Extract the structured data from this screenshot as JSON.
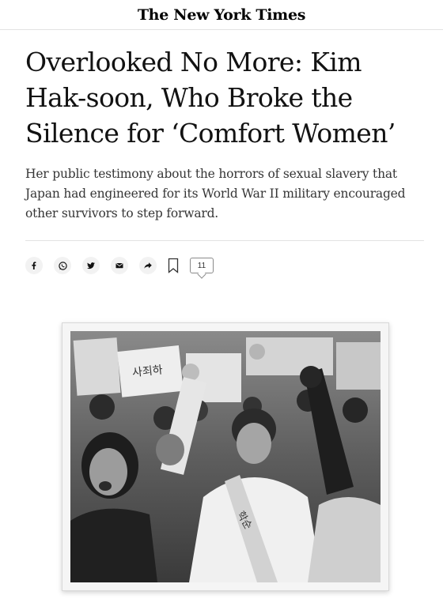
{
  "masthead": {
    "logo_text": "The New York Times"
  },
  "article": {
    "headline": "Overlooked No More: Kim Hak-soon, Who Broke the Silence for ‘Comfort Women’",
    "summary": "Her public testimony about the horrors of sexual slavery that Japan had engineered for its World War II military encouraged other survivors to step forward."
  },
  "share_bar": {
    "buttons": [
      {
        "icon": "facebook-icon"
      },
      {
        "icon": "whatsapp-icon"
      },
      {
        "icon": "twitter-icon"
      },
      {
        "icon": "email-icon"
      },
      {
        "icon": "share-arrow-icon"
      }
    ],
    "bookmark_icon": "bookmark-icon",
    "comment_count": "11"
  },
  "photo": {
    "description_icon": "protest-photo",
    "sash_text": "학순"
  },
  "colors": {
    "text": "#121212",
    "summary_text": "#363636",
    "rule": "#e2e2e2",
    "icon_bg": "#f2f2f2"
  }
}
